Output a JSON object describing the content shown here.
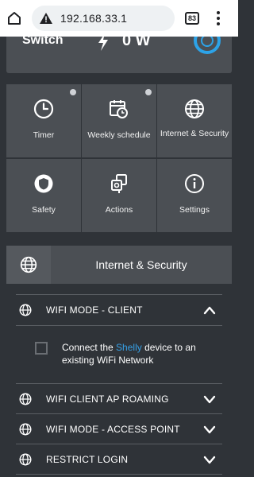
{
  "browser": {
    "url": "192.168.33.1",
    "tab_count": "83"
  },
  "status": {
    "label": "Switch",
    "power": "0 W"
  },
  "tiles": [
    {
      "label": "Timer",
      "icon": "clock-icon",
      "dot": true
    },
    {
      "label": "Weekly schedule",
      "icon": "calendar-schedule-icon",
      "dot": true
    },
    {
      "label": "Internet & Security",
      "icon": "globe-icon",
      "dot": false
    },
    {
      "label": "Safety",
      "icon": "shield-icon",
      "dot": false
    },
    {
      "label": "Actions",
      "icon": "actions-icon",
      "dot": false
    },
    {
      "label": "Settings",
      "icon": "info-icon",
      "dot": false
    }
  ],
  "section": {
    "title": "Internet & Security"
  },
  "wifi_client": {
    "title": "WIFI MODE - CLIENT",
    "expanded": true,
    "checkbox_text_prefix": "Connect the ",
    "checkbox_text_accent": "Shelly",
    "checkbox_text_suffix": " device to an existing WiFi Network",
    "checked": false
  },
  "rows": [
    {
      "label": "WIFI CLIENT AP ROAMING"
    },
    {
      "label": "WIFI MODE - ACCESS POINT"
    },
    {
      "label": "RESTRICT LOGIN"
    }
  ],
  "colors": {
    "accent": "#36a0e6",
    "background": "#2f3338",
    "tile": "#4b4f54"
  }
}
